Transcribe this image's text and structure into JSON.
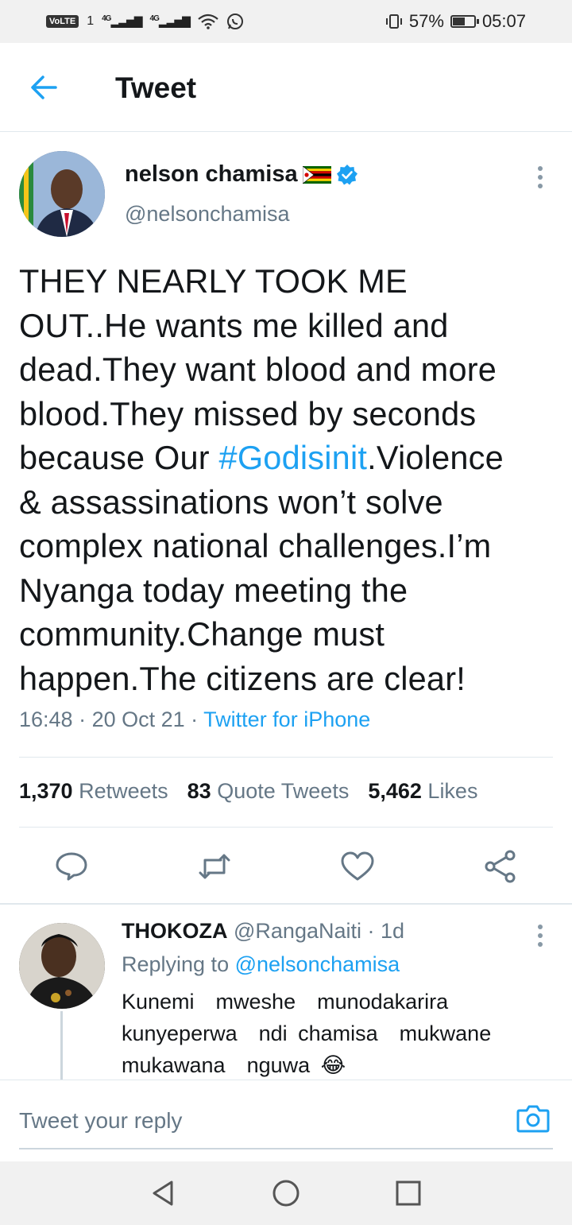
{
  "status_bar": {
    "volte": "VoLTE",
    "sim": "1",
    "net1": "4G",
    "net2": "4G",
    "battery_percent": "57%",
    "battery_level": 0.57,
    "time": "05:07"
  },
  "header": {
    "title": "Tweet"
  },
  "tweet": {
    "author_name": "nelson chamisa",
    "handle": "@nelsonchamisa",
    "text_lines": [
      [
        "THEY NEARLY TOOK ME"
      ],
      [
        "OUT..He wants me killed and"
      ],
      [
        "dead.They want blood and more"
      ],
      [
        "blood.They missed by seconds"
      ],
      [
        "because Our ",
        "#Godisinit",
        ".Violence"
      ],
      [
        "& assassinations won’t solve"
      ],
      [
        "complex national challenges.I’m"
      ],
      [
        "Nyanga today meeting the"
      ],
      [
        "community.Change must"
      ],
      [
        "happen.The citizens are clear!"
      ]
    ],
    "time": "16:48",
    "date": "20 Oct 21",
    "source": "Twitter for iPhone",
    "retweets_count": "1,370",
    "retweets_label": "Retweets",
    "quotes_count": "83",
    "quotes_label": "Quote Tweets",
    "likes_count": "5,462",
    "likes_label": "Likes"
  },
  "reply": {
    "name": "THOKOZA",
    "handle": "@RangaNaiti",
    "age": "1d",
    "replying_prefix": "Replying to",
    "replying_handle": "@nelsonchamisa",
    "line1": "Kunemi  mweshe  munodakarira",
    "line2": "kunyeperwa  ndi chamisa  mukwane",
    "line3": "mukawana  nguwa",
    "emoji": "😂"
  },
  "compose": {
    "placeholder": "Tweet your reply"
  },
  "colors": {
    "accent": "#1da1f2",
    "text": "#14171a",
    "secondary": "#657786",
    "border": "#e1e8ed"
  },
  "icons": [
    "back-arrow-icon",
    "more-vertical-icon",
    "verified-badge-icon",
    "zimbabwe-flag-icon",
    "reply-icon",
    "retweet-icon",
    "like-icon",
    "share-icon",
    "camera-icon",
    "nav-back-icon",
    "nav-home-icon",
    "nav-recents-icon"
  ]
}
